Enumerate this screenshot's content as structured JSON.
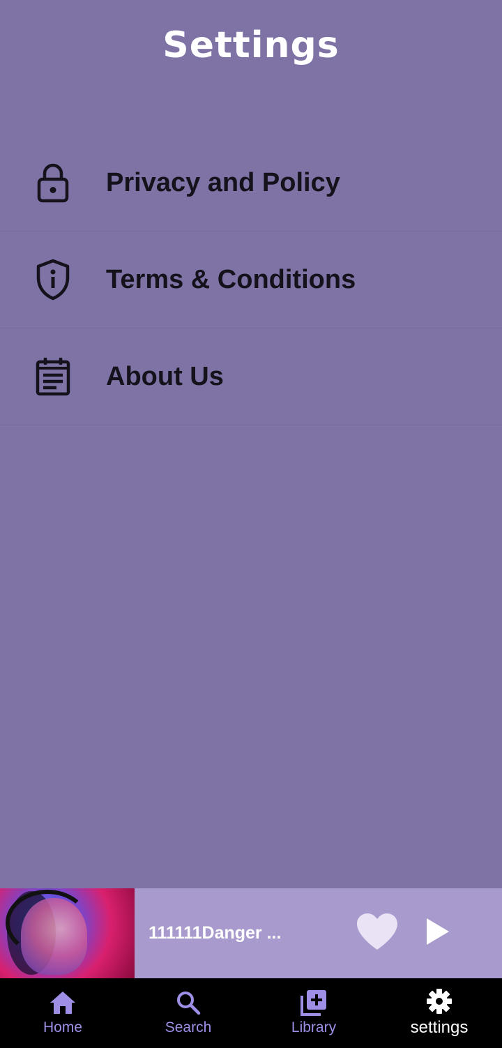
{
  "header": {
    "title": "Settings"
  },
  "menu": {
    "items": [
      {
        "label": "Privacy and Policy",
        "icon": "lock-icon"
      },
      {
        "label": "Terms & Conditions",
        "icon": "shield-info-icon"
      },
      {
        "label": "About Us",
        "icon": "notes-icon"
      }
    ]
  },
  "player": {
    "track_title": "111111Danger ...",
    "artwork": "album-art",
    "like_icon": "heart-icon",
    "play_icon": "play-icon"
  },
  "tabbar": {
    "tabs": [
      {
        "label": "Home",
        "icon": "home-icon"
      },
      {
        "label": "Search",
        "icon": "search-icon"
      },
      {
        "label": "Library",
        "icon": "library-add-icon"
      },
      {
        "label": "settings",
        "icon": "gear-icon"
      }
    ],
    "active": "settings"
  },
  "colors": {
    "background": "#7f73a6",
    "player_bar": "#a99acd",
    "tabbar": "#000000",
    "tab_inactive": "#9e8ee6",
    "tab_active": "#ffffff"
  }
}
